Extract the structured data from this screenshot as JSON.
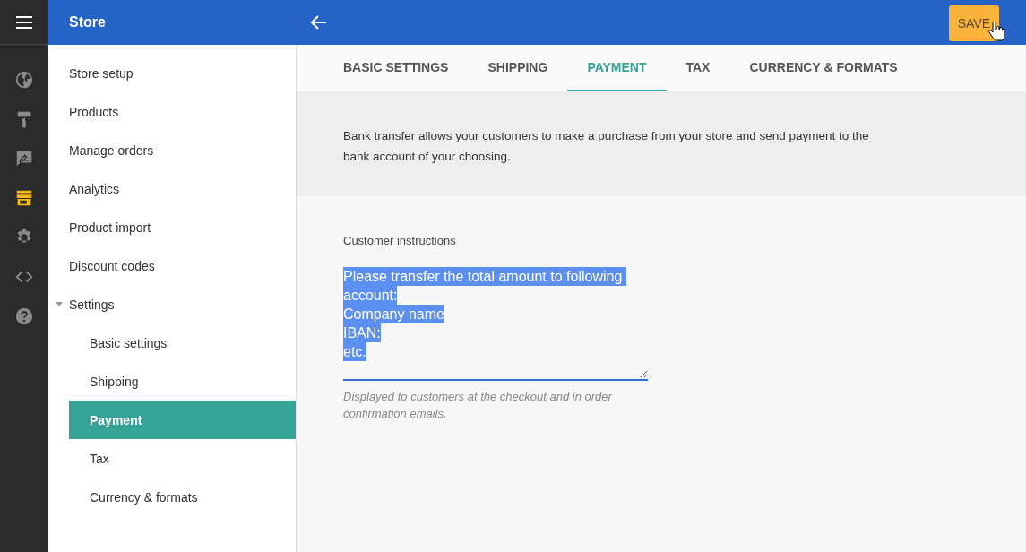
{
  "header": {
    "title": "Store",
    "save_button": "SAVE"
  },
  "rail": [
    {
      "kind": "globe",
      "selected": false
    },
    {
      "kind": "roller",
      "selected": false
    },
    {
      "kind": "chat",
      "selected": false
    },
    {
      "kind": "store",
      "selected": true
    },
    {
      "kind": "gear",
      "selected": false
    },
    {
      "kind": "code",
      "selected": false
    },
    {
      "kind": "help",
      "selected": false
    }
  ],
  "sidebar": {
    "items": [
      {
        "label": "Store setup",
        "selected": false
      },
      {
        "label": "Products",
        "selected": false
      },
      {
        "label": "Manage orders",
        "selected": false
      },
      {
        "label": "Analytics",
        "selected": false
      },
      {
        "label": "Product import",
        "selected": false
      },
      {
        "label": "Discount codes",
        "selected": false
      },
      {
        "label": "Settings",
        "selected": false,
        "expanded": true,
        "children": [
          {
            "label": "Basic settings",
            "selected": false
          },
          {
            "label": "Shipping",
            "selected": false
          },
          {
            "label": "Payment",
            "selected": true
          },
          {
            "label": "Tax",
            "selected": false
          },
          {
            "label": "Currency & formats",
            "selected": false
          }
        ]
      }
    ]
  },
  "tabs": [
    {
      "label": "BASIC SETTINGS",
      "selected": false
    },
    {
      "label": "SHIPPING",
      "selected": false
    },
    {
      "label": "PAYMENT",
      "selected": true
    },
    {
      "label": "TAX",
      "selected": false
    },
    {
      "label": "CURRENCY & FORMATS",
      "selected": false
    }
  ],
  "description": "Bank transfer allows your customers to make a purchase from your store and send payment to the bank account of your choosing.",
  "instructions_field": {
    "label": "Customer instructions",
    "value_lines": [
      "Please transfer the total amount to following ",
      "account:",
      "Company name",
      "IBAN:",
      "etc."
    ],
    "text_selected": true,
    "hint": "Displayed to customers at the checkout and in order confirmation emails."
  }
}
